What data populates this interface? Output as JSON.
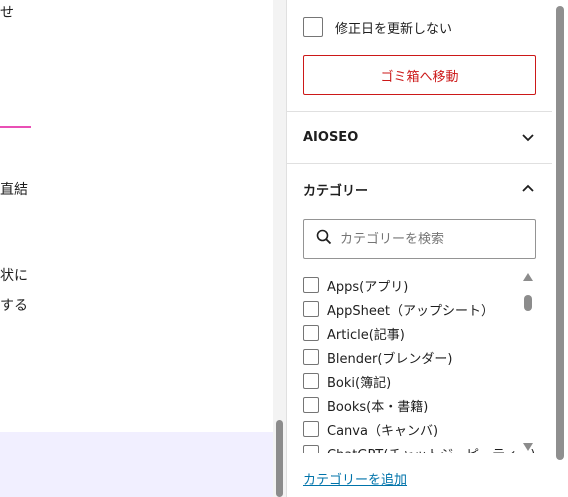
{
  "editor": {
    "lines": [
      "せ",
      "直結",
      "状に",
      "する"
    ]
  },
  "sidebar": {
    "no_update_modified_label": "修正日を更新しない",
    "trash_button_label": "ゴミ箱へ移動",
    "aioseo_panel_title": "AIOSEO",
    "category_panel_title": "カテゴリー",
    "category_search_placeholder": "カテゴリーを検索",
    "categories": [
      "Apps(アプリ)",
      "AppSheet（アップシート）",
      "Article(記事)",
      "Blender(ブレンダー)",
      "Boki(簿記)",
      "Books(本・書籍)",
      "Canva（キャンバ)",
      "ChatGPT(チャットジーピーティー)"
    ],
    "add_category_link": "カテゴリーを追加"
  },
  "colors": {
    "destructive": "#cc1818",
    "link": "#0073aa",
    "accent_pink": "#e94fb5",
    "lavender": "#f1efff"
  },
  "icons": {
    "aioseo_toggle": "chevron-down-icon",
    "category_toggle": "chevron-up-icon",
    "search": "search-icon"
  }
}
